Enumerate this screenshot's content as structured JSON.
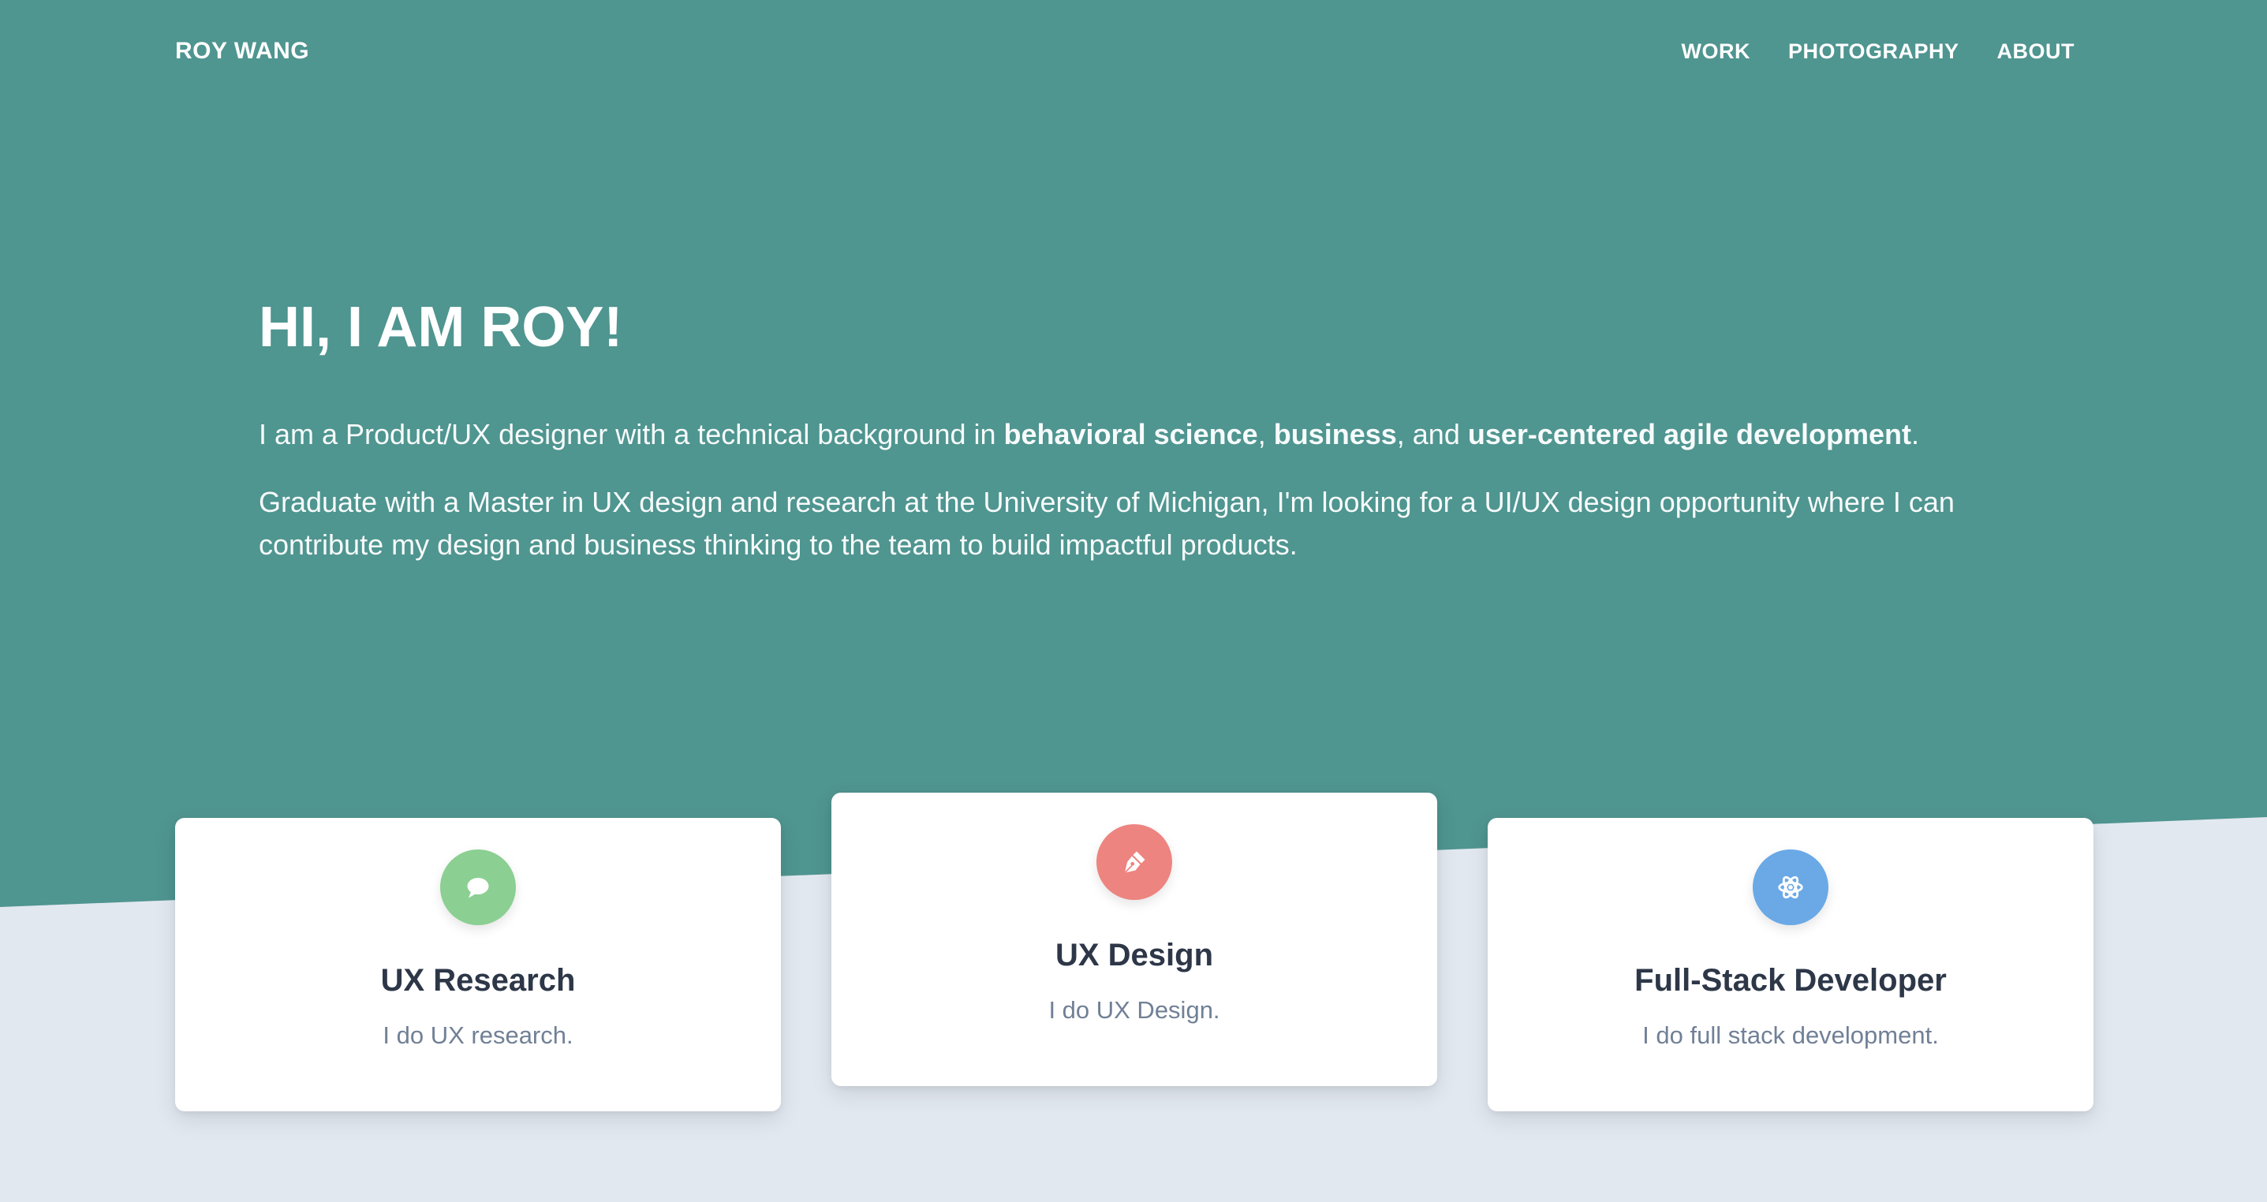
{
  "header": {
    "brand": "ROY WANG",
    "nav": [
      "WORK",
      "PHOTOGRAPHY",
      "ABOUT"
    ]
  },
  "hero": {
    "title": "HI, I AM ROY!",
    "intro": {
      "prefix": "I am a Product/UX designer with a technical background in ",
      "bold1": "behavioral science",
      "sep1": ", ",
      "bold2": "business",
      "sep2": ", and ",
      "bold3": "user-centered agile development",
      "suffix": "."
    },
    "graduate": "Graduate with a Master in UX design and research at the University of Michigan, I'm looking for a UI/UX design opportunity where I can contribute my design and business thinking to the team to build impactful products."
  },
  "cards": [
    {
      "title": "UX Research",
      "text": "I do UX research.",
      "icon": "chat-bubble-icon",
      "color": "#8bcf93"
    },
    {
      "title": "UX Design",
      "text": "I do UX Design.",
      "icon": "pen-nib-icon",
      "color": "#ed8480"
    },
    {
      "title": "Full-Stack Developer",
      "text": "I do full stack development.",
      "icon": "atom-icon",
      "color": "#6aa9e6"
    }
  ],
  "colors": {
    "hero_bg": "#4f9590",
    "page_bg": "#e2e8f0",
    "heading": "#2d3748",
    "muted": "#718096"
  }
}
